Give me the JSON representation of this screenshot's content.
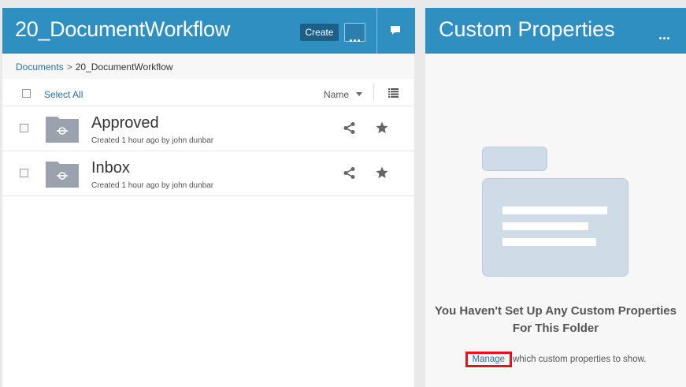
{
  "left": {
    "title": "20_DocumentWorkflow",
    "create_label": "Create",
    "breadcrumb": {
      "root": "Documents",
      "separator": ">",
      "current": "20_DocumentWorkflow"
    },
    "toolbar": {
      "select_all": "Select All",
      "sort_label": "Name"
    },
    "items": [
      {
        "name": "Approved",
        "meta": "Created 1 hour ago by john dunbar"
      },
      {
        "name": "Inbox",
        "meta": "Created 1 hour ago by john dunbar"
      }
    ]
  },
  "right": {
    "title": "Custom Properties",
    "empty_line1": "You Haven't Set Up Any Custom Properties",
    "empty_line2": "For This Folder",
    "manage_label": "Manage",
    "manage_suffix": "which custom properties to show."
  },
  "colors": {
    "header_blue": "#2e8fc0",
    "create_button": "#1d5f86",
    "link_blue": "#2a6fa7",
    "highlight_red": "#e0151f",
    "folder_gray": "#9aa3ad",
    "illustration_blue": "#cfdbe6"
  },
  "icons": [
    "more-icon",
    "chat-icon",
    "list-view-icon",
    "shared-folder-icon",
    "share-icon",
    "star-icon",
    "empty-folder-illustration"
  ]
}
